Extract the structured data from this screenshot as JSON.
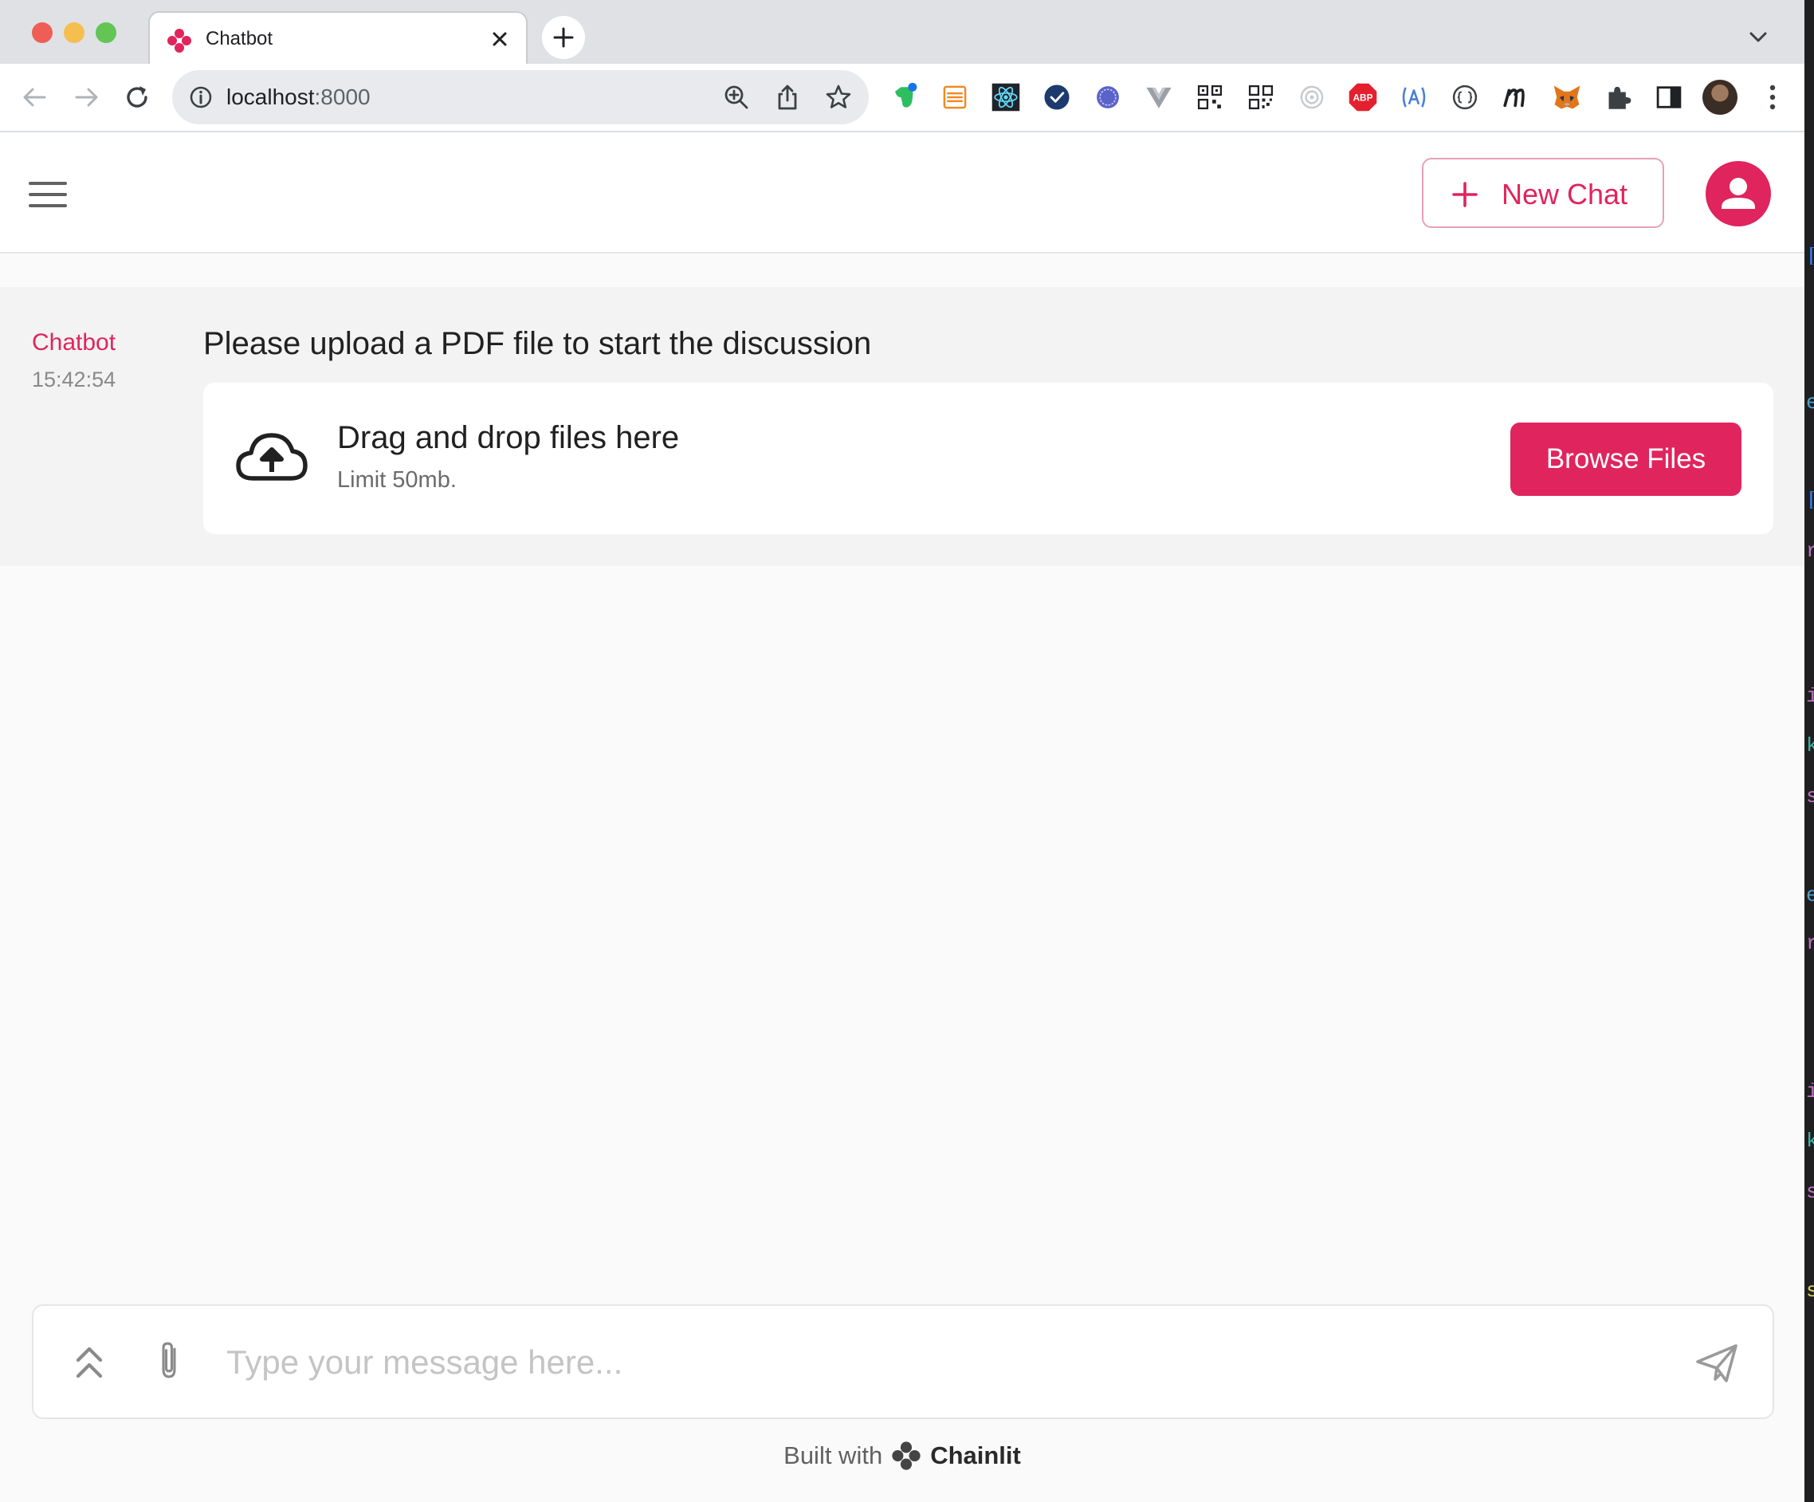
{
  "browser": {
    "tab_title": "Chatbot",
    "url_host": "localhost",
    "url_port": ":8000",
    "extensions": [
      "evernote-icon",
      "stack-icon",
      "react-devtools-icon",
      "check-circle-icon",
      "nordvpn-icon",
      "vue-icon",
      "qr-icon",
      "qr-icon-2",
      "target-icon",
      "adblock-icon",
      "a11y-icon",
      "json-icon",
      "m-icon",
      "metamask-icon",
      "puzzle-icon",
      "sidepanel-icon"
    ],
    "adblock_label": "ABP"
  },
  "header": {
    "new_chat_label": "New Chat"
  },
  "message": {
    "author": "Chatbot",
    "time": "15:42:54",
    "text": "Please upload a PDF file to start the discussion"
  },
  "upload": {
    "title": "Drag and drop files here",
    "limit": "Limit 50mb.",
    "button_label": "Browse Files"
  },
  "composer": {
    "placeholder": "Type your message here..."
  },
  "footer": {
    "prefix": "Built with",
    "brand": "Chainlit"
  },
  "colors": {
    "accent": "#e0245e",
    "background": "#fafafa"
  }
}
